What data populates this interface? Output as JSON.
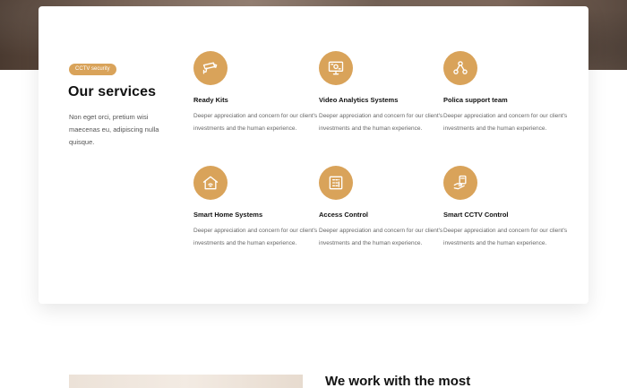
{
  "services_section": {
    "badge": "CCTV security",
    "title": "Our services",
    "intro": "Non eget orci, pretium wisi maecenas eu, adipiscing nulla quisque.",
    "items": [
      {
        "title": "Ready Kits",
        "description": "Deeper appreciation and concern for our client's investments and the human experience.",
        "icon": "cctv-camera-icon"
      },
      {
        "title": "Video Analytics Systems",
        "description": "Deeper appreciation and concern for our client's investments and the human experience.",
        "icon": "monitor-analytics-icon"
      },
      {
        "title": "Polica support team",
        "description": "Deeper appreciation and concern for our client's investments and the human experience.",
        "icon": "network-nodes-icon"
      },
      {
        "title": "Smart Home Systems",
        "description": "Deeper appreciation and concern for our client's investments and the human experience.",
        "icon": "smart-home-icon"
      },
      {
        "title": "Access Control",
        "description": "Deeper appreciation and concern for our client's investments and the human experience.",
        "icon": "access-keypad-icon"
      },
      {
        "title": "Smart CCTV Control",
        "description": "Deeper appreciation and concern for our client's investments and the human experience.",
        "icon": "hand-control-icon"
      }
    ]
  },
  "next_section": {
    "heading": "We work with the most"
  },
  "colors": {
    "accent": "#d9a35a",
    "card_background": "#ffffff",
    "text_dark": "#111111",
    "text_muted": "#666666"
  }
}
